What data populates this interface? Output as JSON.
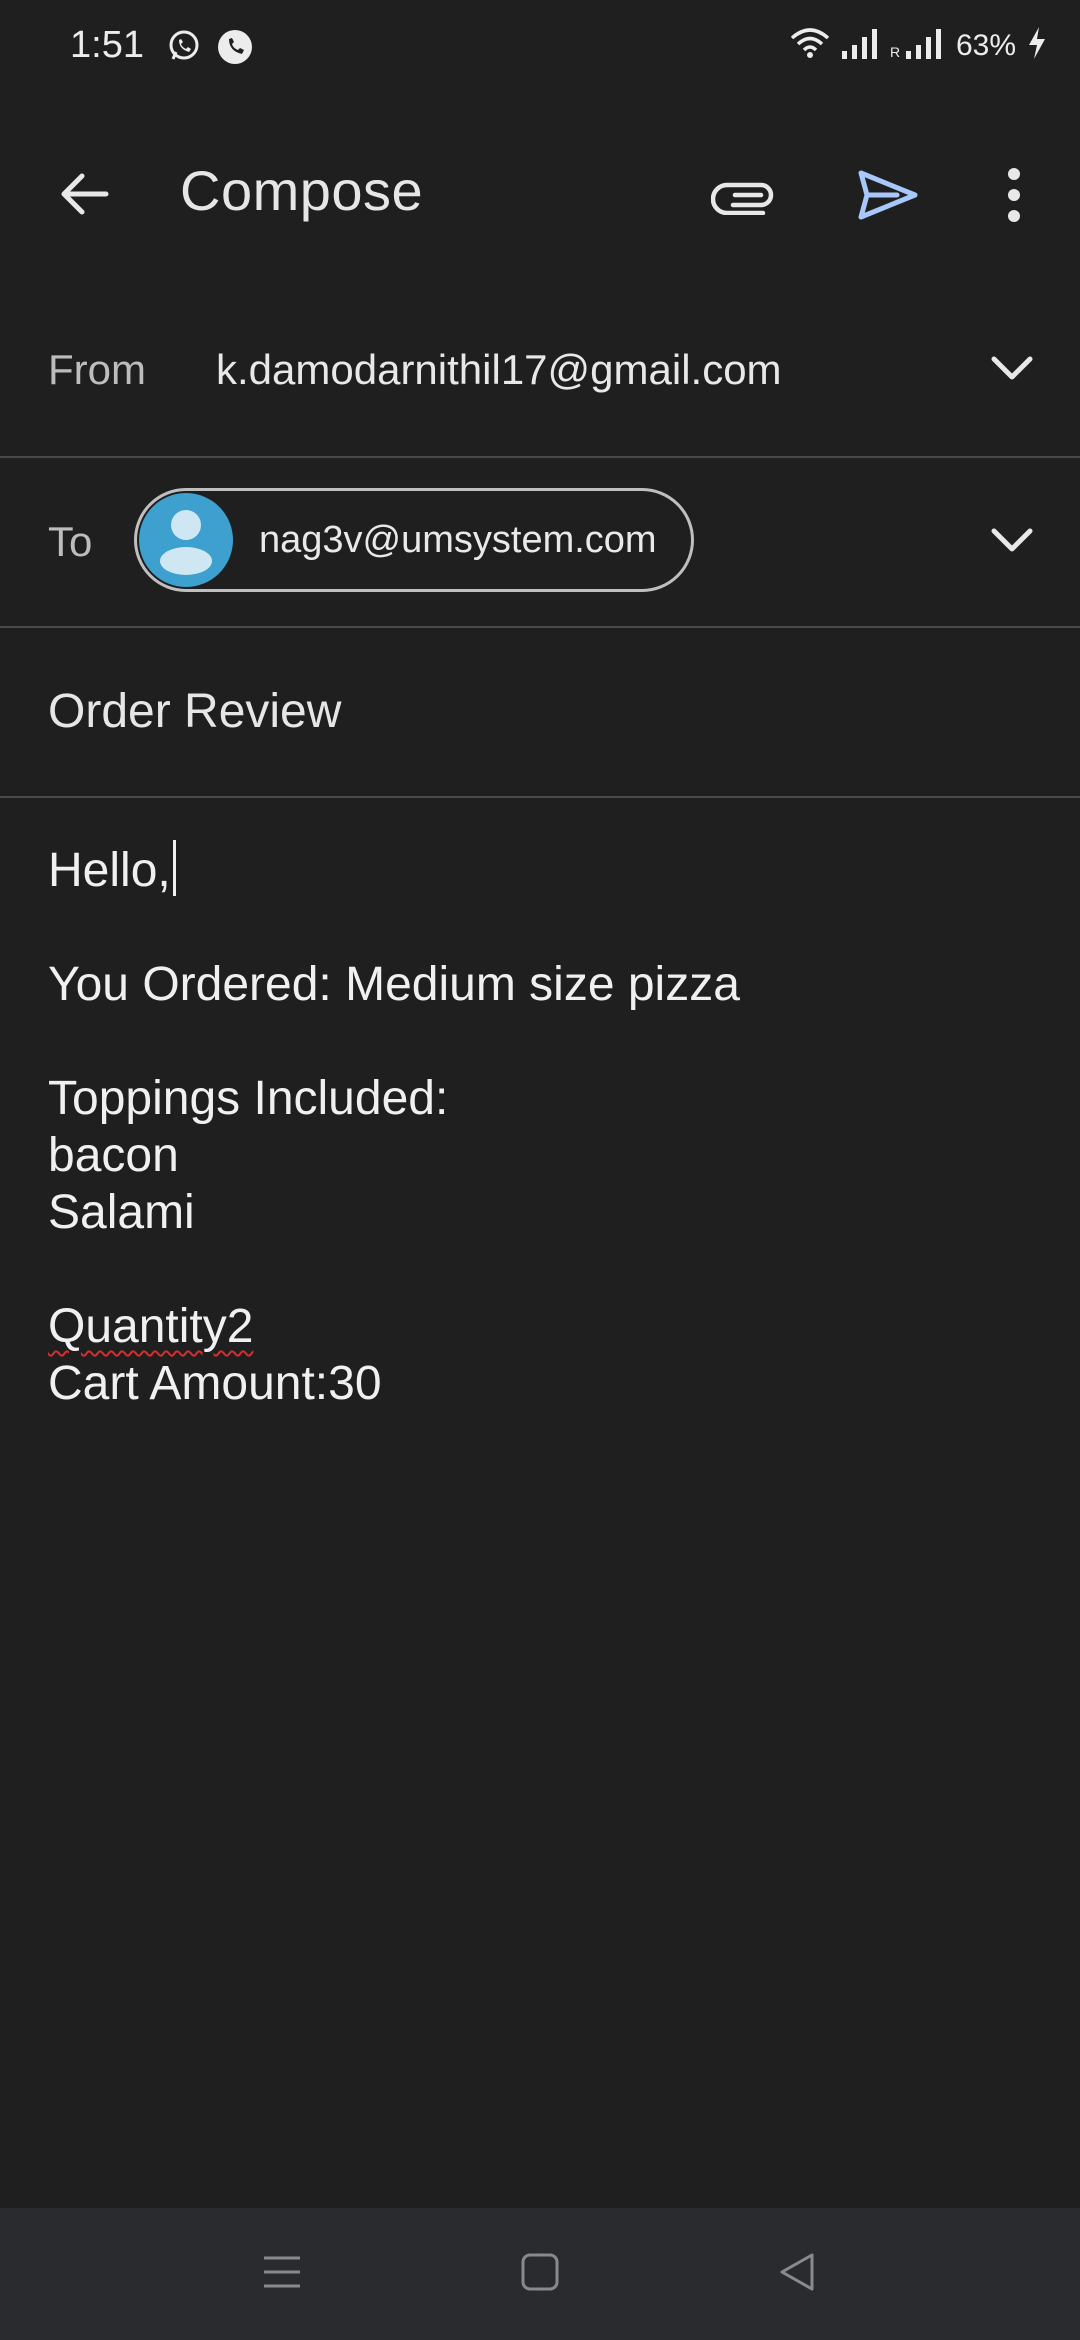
{
  "status_bar": {
    "time": "1:51",
    "battery": "63%",
    "icons": [
      "whatsapp-icon",
      "phone-call-icon",
      "wifi-icon",
      "signal-icon",
      "signal-roaming-icon",
      "charging-icon"
    ]
  },
  "app_bar": {
    "title": "Compose",
    "icons": [
      "back-arrow-icon",
      "paperclip-icon",
      "send-icon",
      "more-vert-icon"
    ],
    "send_color": "#a8c7fa"
  },
  "from": {
    "label": "From",
    "value": "k.damodarnithil17@gmail.com"
  },
  "to": {
    "label": "To",
    "recipient": "nag3v@umsystem.com",
    "avatar_color": "#3ea0cf"
  },
  "subject": {
    "value": "Order Review"
  },
  "body": {
    "lines": [
      "Hello,",
      "",
      "You Ordered: Medium size pizza",
      "",
      "Toppings Included:",
      "bacon",
      "Salami",
      "",
      "Quantity2",
      "Cart Amount:30"
    ]
  },
  "nav_bar": {
    "icons": [
      "menu-icon",
      "home-square-icon",
      "back-triangle-icon"
    ]
  }
}
